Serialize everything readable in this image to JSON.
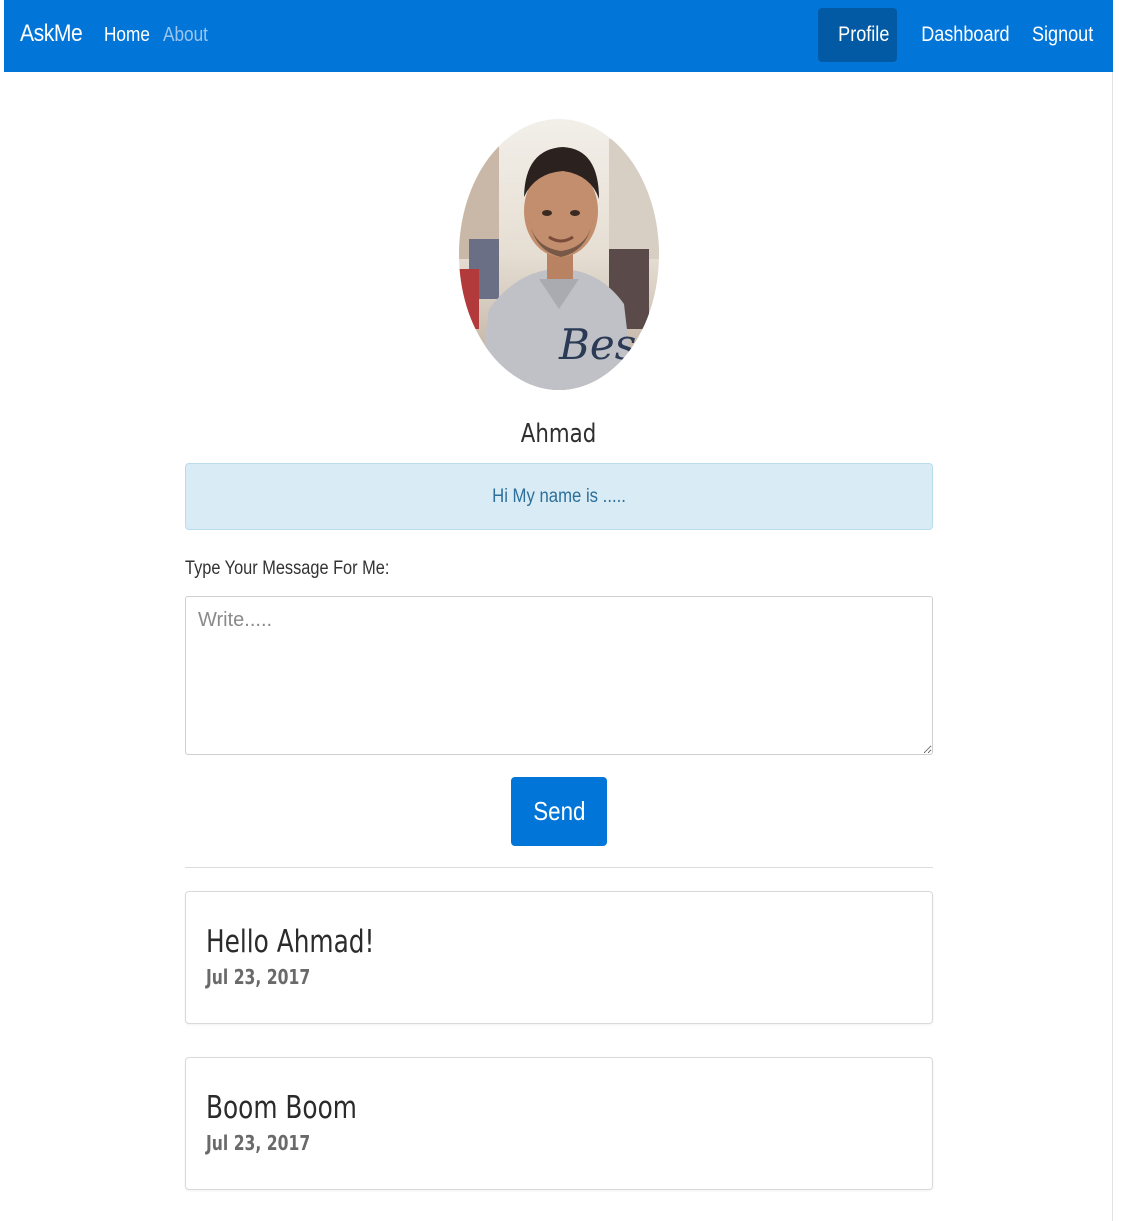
{
  "navbar": {
    "brand": "AskMe",
    "links": [
      {
        "label": "Home"
      },
      {
        "label": "About"
      }
    ],
    "right_links": [
      {
        "label": "Profile",
        "active": true
      },
      {
        "label": "Dashboard"
      },
      {
        "label": "Signout"
      }
    ],
    "color": "#0275d8",
    "active_color": "#025aa5"
  },
  "profile": {
    "name": "Ahmad",
    "bio": "Hi My name is ....."
  },
  "message_form": {
    "label": "Type Your Message For Me:",
    "placeholder": "Write.....",
    "send_label": "Send"
  },
  "messages": [
    {
      "text": "Hello Ahmad!",
      "date": "Jul 23, 2017"
    },
    {
      "text": "Boom Boom",
      "date": "Jul 23, 2017"
    }
  ]
}
